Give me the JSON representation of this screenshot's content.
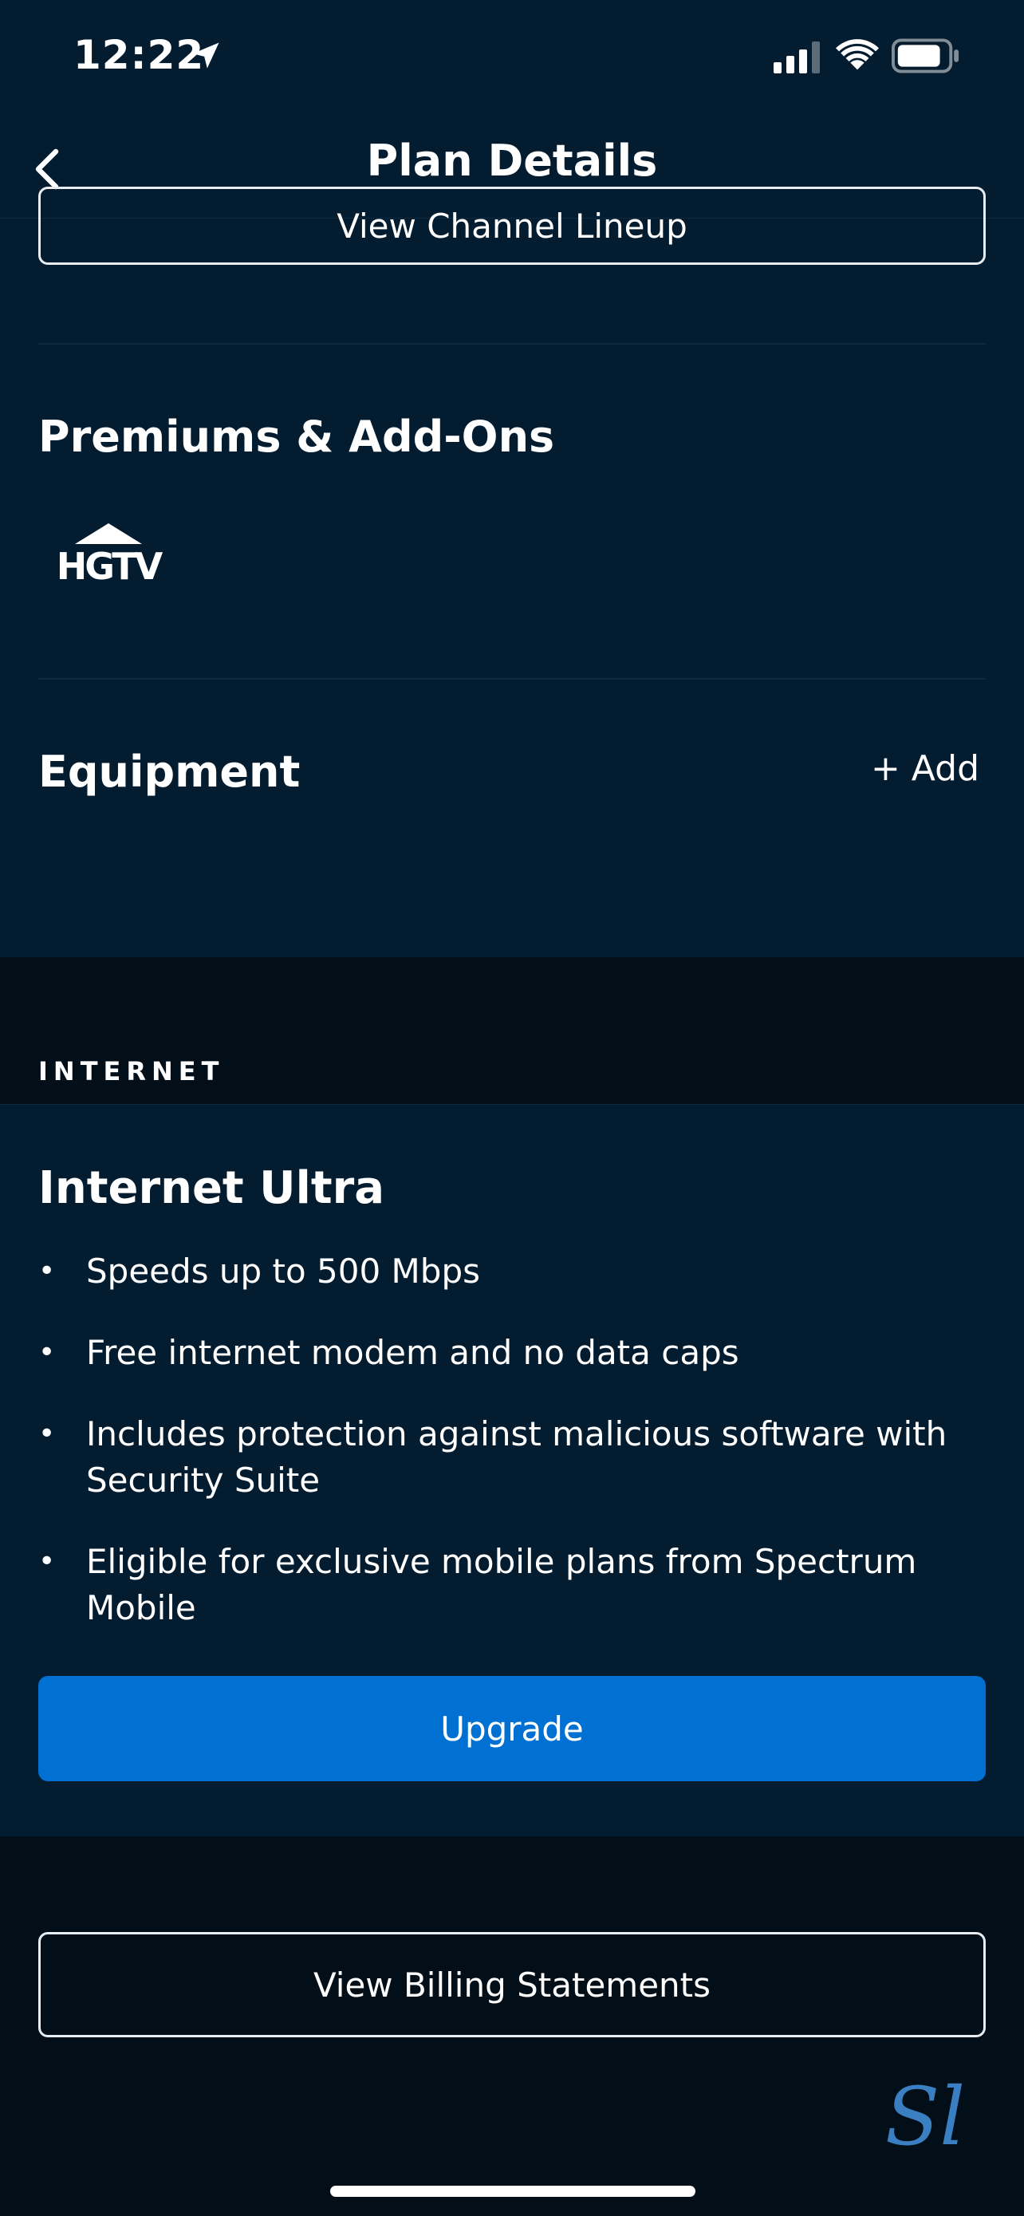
{
  "status_bar": {
    "time": "12:22"
  },
  "nav": {
    "title": "Plan Details"
  },
  "tv": {
    "channel_lineup_label": "View Channel Lineup",
    "premiums_title": "Premiums & Add-Ons",
    "premium_logo": "HGTV",
    "equipment_title": "Equipment",
    "add_label": "+ Add"
  },
  "internet": {
    "section_caption": "INTERNET",
    "plan_name": "Internet Ultra",
    "features": [
      "Speeds up to 500 Mbps",
      "Free internet modem and no data caps",
      "Includes protection against malicious software with Security Suite",
      "Eligible for exclusive mobile plans from Spectrum Mobile"
    ],
    "upgrade_label": "Upgrade"
  },
  "billing": {
    "label": "View Billing Statements"
  },
  "watermark": "Sl",
  "colors": {
    "primary_blue": "#0070d2",
    "panel": "#041c2f",
    "background": "#030f18"
  }
}
